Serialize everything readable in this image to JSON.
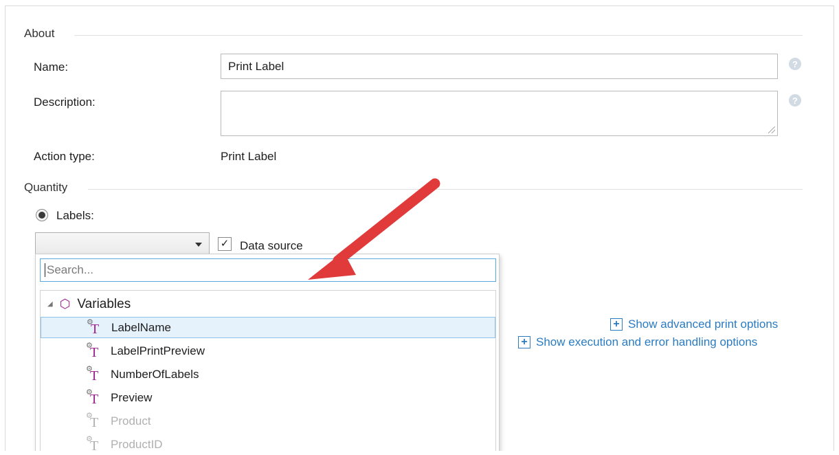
{
  "about": {
    "section_title": "About",
    "name_label": "Name:",
    "name_value": "Print Label",
    "description_label": "Description:",
    "description_value": "",
    "action_type_label": "Action type:",
    "action_type_value": "Print Label",
    "help_glyph": "?"
  },
  "quantity": {
    "section_title": "Quantity",
    "labels_radio_label": "Labels:",
    "data_source_label": "Data source",
    "checkmark": "✓"
  },
  "dropdown": {
    "search_placeholder": "Search...",
    "group_label": "Variables",
    "items": [
      {
        "label": "LabelName",
        "selected": true
      },
      {
        "label": "LabelPrintPreview",
        "selected": false
      },
      {
        "label": "NumberOfLabels",
        "selected": false
      },
      {
        "label": "Preview",
        "selected": false
      },
      {
        "label": "Product",
        "selected": false
      },
      {
        "label": "ProductID",
        "selected": false
      }
    ]
  },
  "options": {
    "advanced_print": "Show advanced print options",
    "execution_error": "Show execution and error handling options",
    "plus_glyph": "+"
  },
  "annotation": {
    "arrow_color": "#e03a3a"
  },
  "colors": {
    "link": "#2a7bc2",
    "variable_glyph": "#9b1f8f",
    "selection_bg": "#e6f2fb"
  }
}
